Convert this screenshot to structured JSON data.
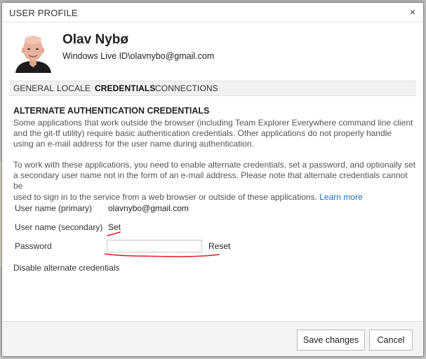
{
  "dialog": {
    "title": "USER PROFILE",
    "close_label": "×"
  },
  "user": {
    "name": "Olav Nybø",
    "id": "Windows Live ID\\olavnybo@gmail.com"
  },
  "tabs": [
    {
      "label": "GENERAL",
      "active": false
    },
    {
      "label": "LOCALE",
      "active": false
    },
    {
      "label": "CREDENTIALS",
      "active": true
    },
    {
      "label": "CONNECTIONS",
      "active": false
    }
  ],
  "credentials": {
    "heading": "ALTERNATE AUTHENTICATION CREDENTIALS",
    "para1_lines": [
      "Some applications that work outside the browser (including Team Explorer Everywhere command line client",
      "and the git-tf utility) require basic authentication credentials. Other applications do not properly handle",
      "using an e-mail address for the user name during authentication."
    ],
    "para2_lines": [
      "To work with these applications, you need to enable alternate credentials, set a password, and optionally set",
      "a secondary user name not in the form of an e-mail address. Please note that alternate credentials cannot be",
      "used to sign in to the service from a web browser or outside of these applications."
    ],
    "learn_more": "Learn more",
    "primary_label": "User name (primary)",
    "primary_value": "olavnybo@gmail.com",
    "secondary_label": "User name (secondary)",
    "secondary_link": "Set",
    "password_label": "Password",
    "password_value": "",
    "reset_link": "Reset",
    "disable_link": "Disable alternate credentials"
  },
  "footer": {
    "save_label": "Save changes",
    "cancel_label": "Cancel"
  },
  "colors": {
    "link": "#1e6ebc",
    "annotation": "#e8191f"
  }
}
